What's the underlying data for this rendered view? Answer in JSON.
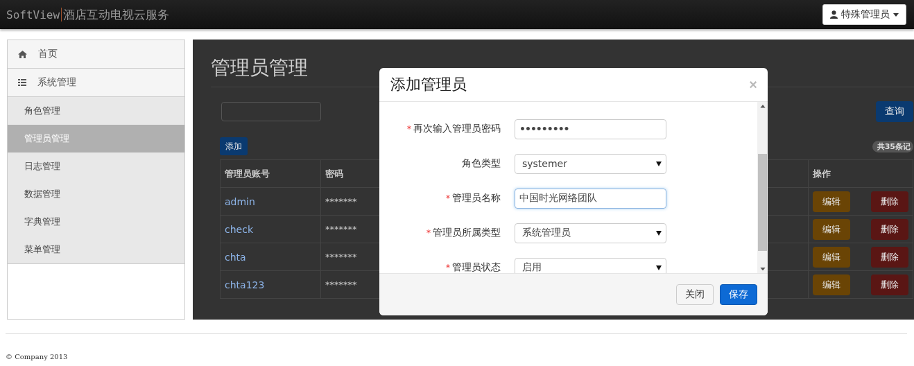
{
  "navbar": {
    "brand": "SoftView",
    "subtitle": "酒店互动电视云服务",
    "user_menu": "特殊管理员"
  },
  "sidebar": {
    "sections": [
      {
        "label": "首页"
      },
      {
        "label": "系统管理",
        "children": [
          {
            "label": "角色管理",
            "selected": false
          },
          {
            "label": "管理员管理",
            "selected": true
          },
          {
            "label": "日志管理",
            "selected": false
          },
          {
            "label": "数据管理",
            "selected": false
          },
          {
            "label": "字典管理",
            "selected": false
          },
          {
            "label": "菜单管理",
            "selected": false
          }
        ]
      }
    ]
  },
  "page": {
    "title": "管理员管理",
    "search_button": "查询",
    "add_button": "添加",
    "record_count": "共35条记",
    "table": {
      "columns": [
        "管理员账号",
        "密码",
        "操作"
      ],
      "rows": [
        {
          "account": "admin",
          "password": "*******",
          "edit": "编辑",
          "delete": "删除"
        },
        {
          "account": "check",
          "password": "*******",
          "edit": "编辑",
          "delete": "删除"
        },
        {
          "account": "chta",
          "password": "*******",
          "edit": "编辑",
          "delete": "删除"
        },
        {
          "account": "chta123",
          "password": "*******",
          "edit": "编辑",
          "delete": "删除"
        }
      ]
    }
  },
  "dialog": {
    "title": "添加管理员",
    "close": "×",
    "fields": [
      {
        "label": "再次输入管理员密码",
        "required_mark": "*",
        "kind": "password",
        "value": "•••••••••"
      },
      {
        "label": "角色类型",
        "kind": "select",
        "value": "systemer"
      },
      {
        "label": "管理员名称",
        "required_mark": "*",
        "kind": "text",
        "value": "中国时光网络团队",
        "focused": true
      },
      {
        "label": "管理员所属类型",
        "required_mark": "*",
        "kind": "select",
        "value": "系统管理员"
      },
      {
        "label": "管理员状态",
        "required_mark": "*",
        "kind": "select",
        "value": "启用"
      }
    ],
    "buttons": [
      {
        "label": "关闭",
        "kind": "default"
      },
      {
        "label": "保存",
        "kind": "primary"
      }
    ]
  },
  "footer": "© Company 2013"
}
